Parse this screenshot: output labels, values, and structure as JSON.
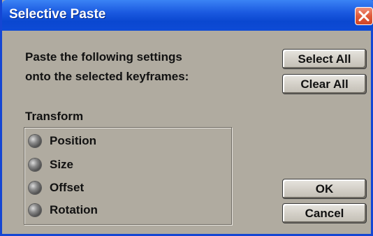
{
  "window": {
    "title": "Selective Paste"
  },
  "prompt": {
    "line1": "Paste the following settings",
    "line2": "onto the selected keyframes:"
  },
  "buttons": {
    "select_all": "Select All",
    "clear_all": "Clear All",
    "ok": "OK",
    "cancel": "Cancel"
  },
  "transform": {
    "label": "Transform",
    "options": [
      {
        "label": "Position"
      },
      {
        "label": "Size"
      },
      {
        "label": "Offset"
      },
      {
        "label": "Rotation"
      }
    ]
  },
  "colors": {
    "titlebar": "#0a47d0",
    "dialog_bg": "#b0aba0",
    "close_button": "#e05a3a"
  },
  "icons": {
    "close": "close-icon",
    "radio": "radio-icon"
  }
}
